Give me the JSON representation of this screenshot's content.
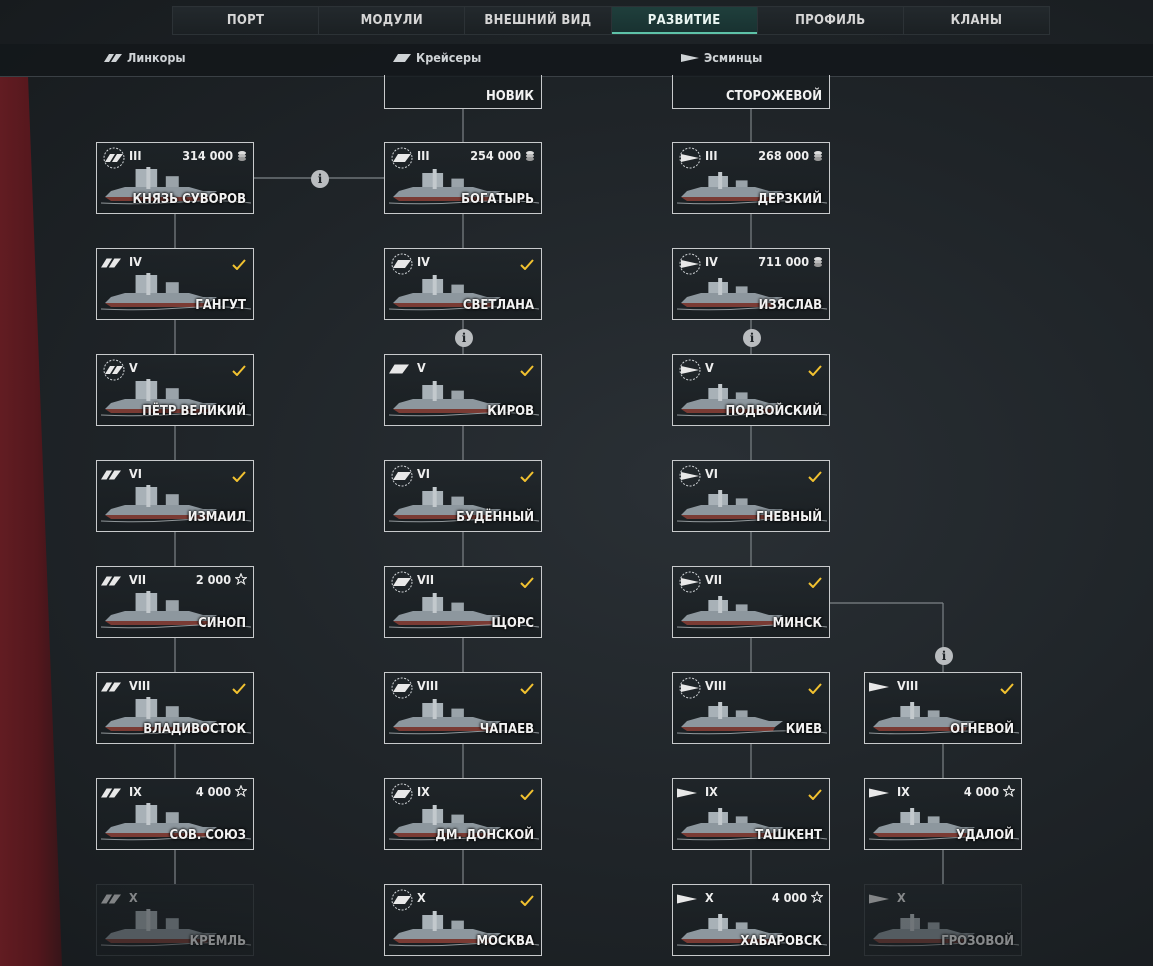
{
  "nav": {
    "tabs": [
      {
        "label": "ПОРТ"
      },
      {
        "label": "МОДУЛИ"
      },
      {
        "label": "ВНЕШНИЙ ВИД"
      },
      {
        "label": "РАЗВИТИЕ"
      },
      {
        "label": "ПРОФИЛЬ"
      },
      {
        "label": "КЛАНЫ"
      }
    ],
    "active_index": 3
  },
  "categories": [
    {
      "label": "Линкоры",
      "icon": "battleship-icon"
    },
    {
      "label": "Крейсеры",
      "icon": "cruiser-icon"
    },
    {
      "label": "Эсминцы",
      "icon": "destroyer-icon"
    }
  ],
  "top_stubs": [
    {
      "name": "НОВИК"
    },
    {
      "name": "СТОРОЖЕВОЙ"
    }
  ],
  "colors": {
    "accent": "#5ec2a8",
    "check": "#f2c230",
    "border": "#c8cacc"
  },
  "ships": [
    {
      "col": 0,
      "row": 0,
      "cls": "battleship",
      "elite": true,
      "tier": "III",
      "name": "КНЯЗЬ СУВОРОВ",
      "price": "314 000",
      "currency": "credits-icon",
      "researched": false,
      "locked": false
    },
    {
      "col": 0,
      "row": 1,
      "cls": "battleship",
      "elite": false,
      "tier": "IV",
      "name": "ГАНГУТ",
      "price": "",
      "currency": "",
      "researched": true,
      "locked": false
    },
    {
      "col": 0,
      "row": 2,
      "cls": "battleship",
      "elite": true,
      "tier": "V",
      "name": "ПЁТР ВЕЛИКИЙ",
      "price": "",
      "currency": "",
      "researched": true,
      "locked": false
    },
    {
      "col": 0,
      "row": 3,
      "cls": "battleship",
      "elite": false,
      "tier": "VI",
      "name": "ИЗМАИЛ",
      "price": "",
      "currency": "",
      "researched": true,
      "locked": false
    },
    {
      "col": 0,
      "row": 4,
      "cls": "battleship",
      "elite": false,
      "tier": "VII",
      "name": "СИНОП",
      "price": "2 000",
      "currency": "xp-star-icon",
      "researched": false,
      "locked": false
    },
    {
      "col": 0,
      "row": 5,
      "cls": "battleship",
      "elite": false,
      "tier": "VIII",
      "name": "ВЛАДИВОСТОК",
      "price": "",
      "currency": "",
      "researched": true,
      "locked": false
    },
    {
      "col": 0,
      "row": 6,
      "cls": "battleship",
      "elite": false,
      "tier": "IX",
      "name": "СОВ. СОЮЗ",
      "price": "4 000",
      "currency": "xp-star-icon",
      "researched": false,
      "locked": false
    },
    {
      "col": 0,
      "row": 7,
      "cls": "battleship",
      "elite": false,
      "tier": "X",
      "name": "КРЕМЛЬ",
      "price": "",
      "currency": "",
      "researched": false,
      "locked": true
    },
    {
      "col": 1,
      "row": 0,
      "cls": "cruiser",
      "elite": true,
      "tier": "III",
      "name": "БОГАТЫРЬ",
      "price": "254 000",
      "currency": "credits-icon",
      "researched": false,
      "locked": false
    },
    {
      "col": 1,
      "row": 1,
      "cls": "cruiser",
      "elite": true,
      "tier": "IV",
      "name": "СВЕТЛАНА",
      "price": "",
      "currency": "",
      "researched": true,
      "locked": false
    },
    {
      "col": 1,
      "row": 2,
      "cls": "cruiser",
      "elite": false,
      "tier": "V",
      "name": "КИРОВ",
      "price": "",
      "currency": "",
      "researched": true,
      "locked": false
    },
    {
      "col": 1,
      "row": 3,
      "cls": "cruiser",
      "elite": true,
      "tier": "VI",
      "name": "БУДЁННЫЙ",
      "price": "",
      "currency": "",
      "researched": true,
      "locked": false
    },
    {
      "col": 1,
      "row": 4,
      "cls": "cruiser",
      "elite": true,
      "tier": "VII",
      "name": "ЩОРС",
      "price": "",
      "currency": "",
      "researched": true,
      "locked": false
    },
    {
      "col": 1,
      "row": 5,
      "cls": "cruiser",
      "elite": true,
      "tier": "VIII",
      "name": "ЧАПАЕВ",
      "price": "",
      "currency": "",
      "researched": true,
      "locked": false
    },
    {
      "col": 1,
      "row": 6,
      "cls": "cruiser",
      "elite": true,
      "tier": "IX",
      "name": "ДМ. ДОНСКОЙ",
      "price": "",
      "currency": "",
      "researched": true,
      "locked": false
    },
    {
      "col": 1,
      "row": 7,
      "cls": "cruiser",
      "elite": true,
      "tier": "X",
      "name": "МОСКВА",
      "price": "",
      "currency": "",
      "researched": true,
      "locked": false
    },
    {
      "col": 2,
      "row": 0,
      "cls": "destroyer",
      "elite": true,
      "tier": "III",
      "name": "ДЕРЗКИЙ",
      "price": "268 000",
      "currency": "credits-icon",
      "researched": false,
      "locked": false
    },
    {
      "col": 2,
      "row": 1,
      "cls": "destroyer",
      "elite": true,
      "tier": "IV",
      "name": "ИЗЯСЛАВ",
      "price": "711 000",
      "currency": "credits-icon",
      "researched": false,
      "locked": false
    },
    {
      "col": 2,
      "row": 2,
      "cls": "destroyer",
      "elite": true,
      "tier": "V",
      "name": "ПОДВОЙСКИЙ",
      "price": "",
      "currency": "",
      "researched": true,
      "locked": false
    },
    {
      "col": 2,
      "row": 3,
      "cls": "destroyer",
      "elite": true,
      "tier": "VI",
      "name": "ГНЕВНЫЙ",
      "price": "",
      "currency": "",
      "researched": true,
      "locked": false
    },
    {
      "col": 2,
      "row": 4,
      "cls": "destroyer",
      "elite": true,
      "tier": "VII",
      "name": "МИНСК",
      "price": "",
      "currency": "",
      "researched": true,
      "locked": false
    },
    {
      "col": 2,
      "row": 5,
      "cls": "destroyer",
      "elite": true,
      "tier": "VIII",
      "name": "КИЕВ",
      "price": "",
      "currency": "",
      "researched": true,
      "locked": false
    },
    {
      "col": 2,
      "row": 6,
      "cls": "destroyer",
      "elite": false,
      "tier": "IX",
      "name": "ТАШКЕНТ",
      "price": "",
      "currency": "",
      "researched": true,
      "locked": false
    },
    {
      "col": 2,
      "row": 7,
      "cls": "destroyer",
      "elite": false,
      "tier": "X",
      "name": "ХАБАРОВСК",
      "price": "4 000",
      "currency": "xp-star-icon",
      "researched": false,
      "locked": false
    },
    {
      "col": 3,
      "row": 5,
      "cls": "destroyer",
      "elite": false,
      "tier": "VIII",
      "name": "ОГНЕВОЙ",
      "price": "",
      "currency": "",
      "researched": true,
      "locked": false
    },
    {
      "col": 3,
      "row": 6,
      "cls": "destroyer",
      "elite": false,
      "tier": "IX",
      "name": "УДАЛОЙ",
      "price": "4 000",
      "currency": "xp-star-icon",
      "researched": false,
      "locked": false
    },
    {
      "col": 3,
      "row": 7,
      "cls": "destroyer",
      "elite": false,
      "tier": "X",
      "name": "ГРОЗОВОЙ",
      "price": "",
      "currency": "",
      "researched": false,
      "locked": true
    }
  ]
}
